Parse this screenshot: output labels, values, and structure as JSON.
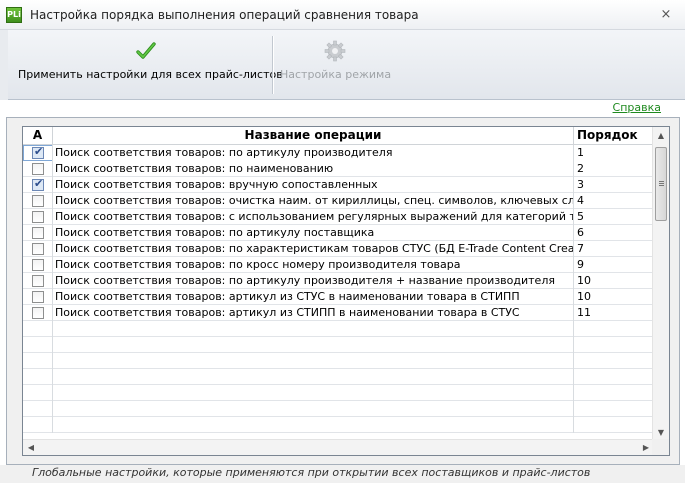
{
  "window": {
    "icon_text": "PLi",
    "title": "Настройка порядка выполнения операций сравнения товара",
    "close_glyph": "×"
  },
  "toolbar": {
    "apply_label": "Применить настройки для всех прайс-листов",
    "mode_label": "Настройка режима",
    "apply_icon": "checkmark-icon",
    "mode_icon": "gear-icon",
    "mode_enabled": false
  },
  "help_link": "Справка",
  "grid": {
    "columns": {
      "a": "A",
      "name": "Название операции",
      "order": "Порядок"
    },
    "rows": [
      {
        "checked": true,
        "name": "Поиск соответствия товаров: по артикулу производителя",
        "order": "1",
        "selected": true
      },
      {
        "checked": false,
        "name": "Поиск соответствия товаров: по наименованию",
        "order": "2"
      },
      {
        "checked": true,
        "name": "Поиск соответствия товаров: вручную сопоставленных",
        "order": "3"
      },
      {
        "checked": false,
        "name": "Поиск соответствия товаров: очистка наим. от кириллицы, спец. символов, ключевых слов, поиск по",
        "order": "4"
      },
      {
        "checked": false,
        "name": "Поиск соответствия товаров: с использованием регулярных выражений для категорий товара",
        "order": "5"
      },
      {
        "checked": false,
        "name": "Поиск соответствия товаров: по артикулу поставщика",
        "order": "6"
      },
      {
        "checked": false,
        "name": "Поиск соответствия товаров: по характеристикам товаров СТУС (БД E-Trade Content Creator)",
        "order": "7"
      },
      {
        "checked": false,
        "name": "Поиск соответствия товаров: по кросс номеру производителя товара",
        "order": "9"
      },
      {
        "checked": false,
        "name": "Поиск соответствия товаров: по артикулу производителя + название производителя",
        "order": "10"
      },
      {
        "checked": false,
        "name": "Поиск соответствия товаров: артикул из СТУС в наименовании товара в СТИПП",
        "order": "10"
      },
      {
        "checked": false,
        "name": "Поиск соответствия товаров: артикул из СТИПП в наименовании товара в СТУС",
        "order": "11"
      }
    ],
    "empty_rows": 7
  },
  "statusbar": {
    "text": "Глобальные настройки, которые применяются при открытии всех поставщиков и прайс-листов"
  },
  "colors": {
    "accent_green": "#3fa12a",
    "link_green": "#1f8a1f",
    "selection_outline": "#7fa7d6"
  }
}
